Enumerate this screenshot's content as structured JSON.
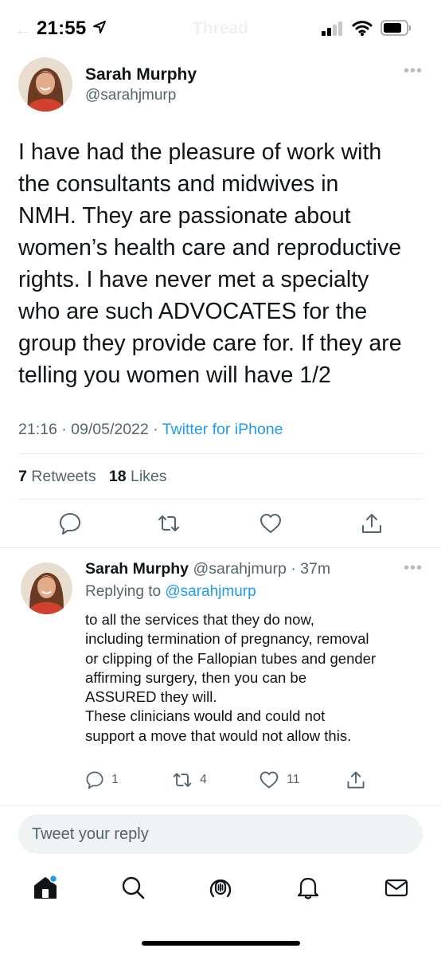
{
  "status_bar": {
    "time": "21:55",
    "location_icon": "location-arrow-icon",
    "signal_icon": "cellular-signal-icon",
    "wifi_icon": "wifi-icon",
    "battery_icon": "battery-icon"
  },
  "header": {
    "back_icon": "back-arrow-icon",
    "title": "Thread"
  },
  "main_tweet": {
    "author_name": "Sarah Murphy",
    "author_handle": "@sarahjmurp",
    "text": "I have had the pleasure of work with\nthe consultants and midwives in\nNMH. They are passionate about\nwomen’s health care and reproductive\nrights. I have never met a specialty\nwho are such ADVOCATES for the\ngroup they provide care for. If they are\ntelling you women will have 1/2",
    "time": "21:16",
    "date": "09/05/2022",
    "source": "Twitter for iPhone",
    "retweets_count": "7",
    "retweets_label": "Retweets",
    "likes_count": "18",
    "likes_label": "Likes",
    "actions": [
      "reply-icon",
      "retweet-icon",
      "like-icon",
      "share-icon"
    ]
  },
  "reply_tweet": {
    "author_name": "Sarah Murphy",
    "author_handle": "@sarahjmurp",
    "age": "37m",
    "replying_prefix": "Replying to",
    "replying_handle": "@sarahjmurp",
    "text": "to all the services that they do now,\nincluding termination of pregnancy, removal\nor clipping of the Fallopian tubes and gender\naffirming surgery, then you can be\nASSURED they will.\nThese clinicians would and could not\nsupport a move that would not allow this.",
    "reply_count": "1",
    "retweet_count": "4",
    "like_count": "11"
  },
  "composer": {
    "placeholder": "Tweet your reply"
  },
  "tab_bar": {
    "items": [
      "home-icon",
      "explore-icon",
      "spaces-icon",
      "notifications-icon",
      "messages-icon"
    ]
  },
  "colors": {
    "accent": "#1d9bf0",
    "text_primary": "#0f1419",
    "text_secondary": "#536471",
    "divider": "#e7e9eb",
    "composer_bg": "#eff3f4"
  }
}
